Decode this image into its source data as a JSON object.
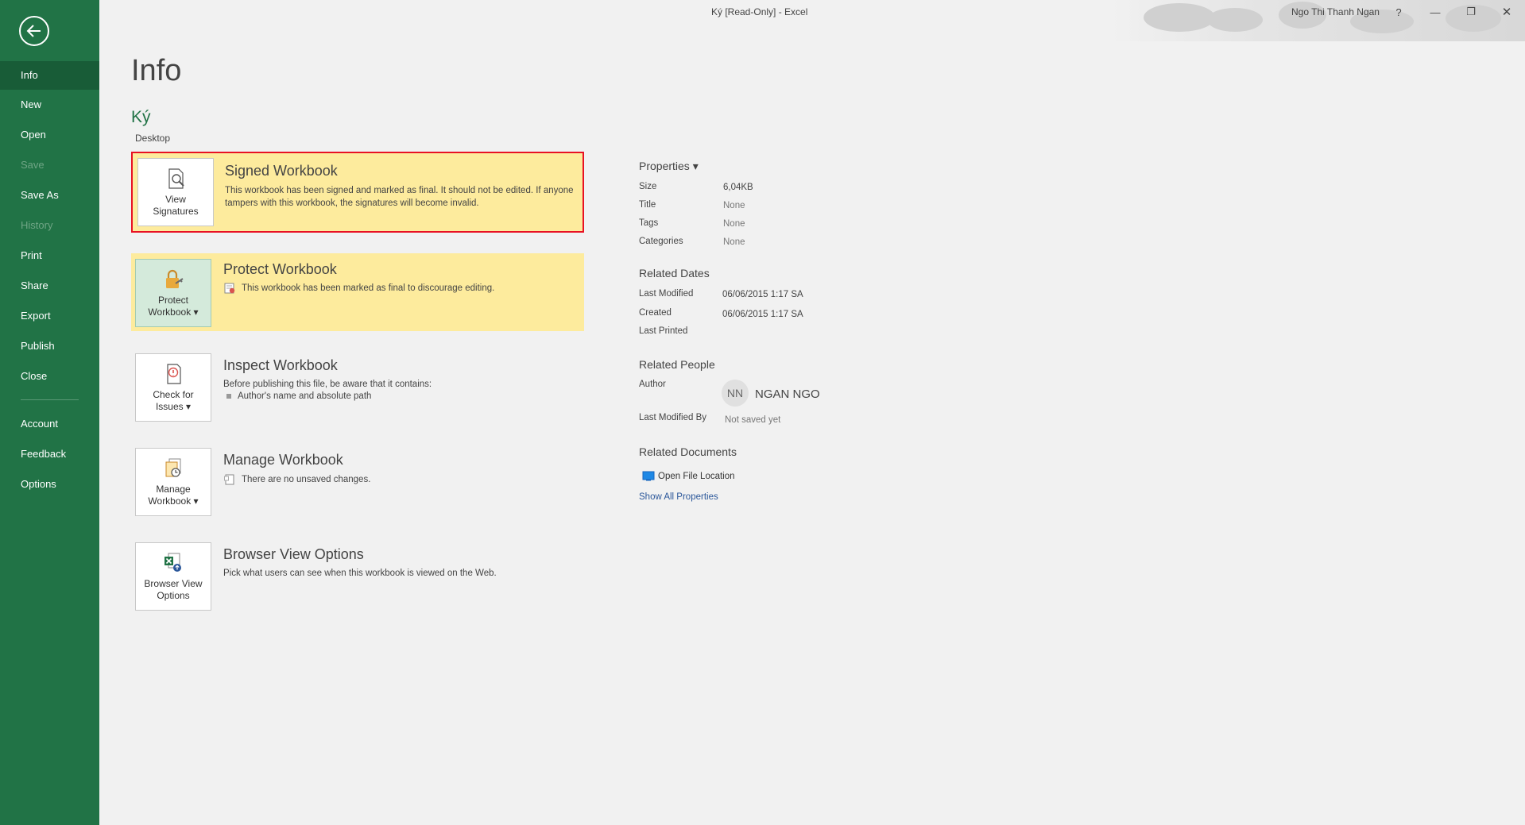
{
  "window": {
    "title": "Ký  [Read-Only]  -  Excel",
    "user": "Ngo Thi Thanh Ngan",
    "help": "?",
    "minimize": "—",
    "restore": "❐",
    "close": "✕"
  },
  "sidebar": {
    "items": [
      {
        "label": "Info",
        "state": "active"
      },
      {
        "label": "New"
      },
      {
        "label": "Open"
      },
      {
        "label": "Save",
        "state": "disabled"
      },
      {
        "label": "Save As"
      },
      {
        "label": "History",
        "state": "disabled"
      },
      {
        "label": "Print"
      },
      {
        "label": "Share"
      },
      {
        "label": "Export"
      },
      {
        "label": "Publish"
      },
      {
        "label": "Close"
      },
      {
        "label": "Account"
      },
      {
        "label": "Feedback"
      },
      {
        "label": "Options"
      }
    ]
  },
  "main": {
    "title": "Info",
    "file_name": "Ký",
    "file_location": "Desktop"
  },
  "sections": {
    "signed": {
      "button_line1": "View",
      "button_line2": "Signatures",
      "title": "Signed Workbook",
      "desc": "This workbook has been signed and marked as final. It should not be edited.  If anyone tampers with this workbook, the signatures will become invalid."
    },
    "protect": {
      "button_line1": "Protect",
      "button_line2": "Workbook ▾",
      "title": "Protect Workbook",
      "desc": "This workbook has been marked as final to discourage editing."
    },
    "inspect": {
      "button_line1": "Check for",
      "button_line2": "Issues ▾",
      "title": "Inspect Workbook",
      "desc": "Before publishing this file, be aware that it contains:",
      "bullet": "Author's name and absolute path"
    },
    "manage": {
      "button_line1": "Manage",
      "button_line2": "Workbook ▾",
      "title": "Manage Workbook",
      "desc": "There are no unsaved changes."
    },
    "browser": {
      "button_line1": "Browser View",
      "button_line2": "Options",
      "title": "Browser View Options",
      "desc": "Pick what users can see when this workbook is viewed on the Web."
    }
  },
  "properties": {
    "heading": "Properties ▾",
    "size_label": "Size",
    "size": "6,04KB",
    "title_label": "Title",
    "title": "None",
    "tags_label": "Tags",
    "tags": "None",
    "categories_label": "Categories",
    "categories": "None",
    "dates_heading": "Related Dates",
    "modified_label": "Last Modified",
    "modified": "06/06/2015 1:17 SA",
    "created_label": "Created",
    "created": "06/06/2015 1:17 SA",
    "printed_label": "Last Printed",
    "people_heading": "Related People",
    "author_label": "Author",
    "author_initials": "NN",
    "author": "NGAN NGO",
    "modified_by_label": "Last Modified By",
    "modified_by": "Not saved yet",
    "docs_heading": "Related Documents",
    "open_location": "Open File Location",
    "show_all": "Show All Properties"
  },
  "colors": {
    "sidebar": "#217346",
    "sidebar_active": "#185c37",
    "highlight": "#fdeb9d",
    "alert_border": "#e81123",
    "link": "#2b579a"
  }
}
